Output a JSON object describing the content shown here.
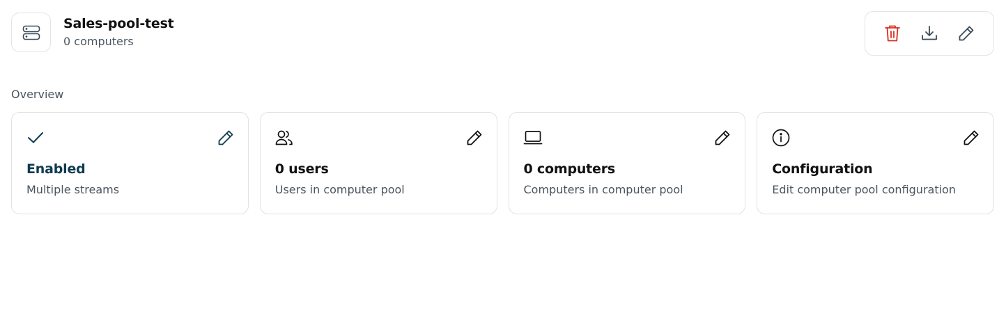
{
  "header": {
    "title": "Sales-pool-test",
    "subtitle": "0 computers",
    "icon": "server-icon"
  },
  "actions": [
    {
      "name": "delete",
      "icon": "trash-icon",
      "color": "#d92d20"
    },
    {
      "name": "download",
      "icon": "download-icon",
      "color": "#3b4a56"
    },
    {
      "name": "edit",
      "icon": "pencil-icon",
      "color": "#3b4a56"
    }
  ],
  "section": {
    "label": "Overview"
  },
  "cards": [
    {
      "icon": "check-icon",
      "title": "Enabled",
      "description": "Multiple streams",
      "accent": "#0f3b4f"
    },
    {
      "icon": "users-icon",
      "title": "0 users",
      "description": "Users in computer pool"
    },
    {
      "icon": "laptop-icon",
      "title": "0 computers",
      "description": "Computers in computer pool"
    },
    {
      "icon": "info-icon",
      "title": "Configuration",
      "description": "Edit computer pool configuration"
    }
  ]
}
